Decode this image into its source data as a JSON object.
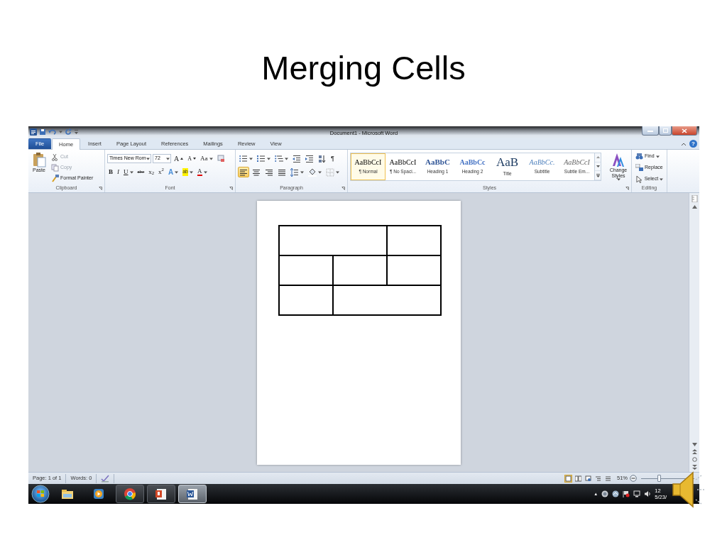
{
  "slide_title": "Merging Cells",
  "window": {
    "title": "Document1 - Microsoft Word"
  },
  "tabs": [
    {
      "label": "File",
      "kind": "file",
      "selected": false
    },
    {
      "label": "Home",
      "kind": "tab",
      "selected": true
    },
    {
      "label": "Insert",
      "kind": "tab",
      "selected": false
    },
    {
      "label": "Page Layout",
      "kind": "tab",
      "selected": false
    },
    {
      "label": "References",
      "kind": "tab",
      "selected": false
    },
    {
      "label": "Mailings",
      "kind": "tab",
      "selected": false
    },
    {
      "label": "Review",
      "kind": "tab",
      "selected": false
    },
    {
      "label": "View",
      "kind": "tab",
      "selected": false
    }
  ],
  "help": "?",
  "clipboard": {
    "label": "Clipboard",
    "paste": "Paste",
    "items": [
      {
        "label": "Cut",
        "kind": "cut",
        "disabled": true
      },
      {
        "label": "Copy",
        "kind": "copy",
        "disabled": true
      },
      {
        "label": "Format Painter",
        "kind": "painter",
        "disabled": false
      }
    ]
  },
  "font": {
    "label": "Font",
    "name": "Times New Rom",
    "size": "72",
    "row1": [
      {
        "label": "A",
        "kind": "grow"
      },
      {
        "label": "A",
        "kind": "shrink"
      },
      {
        "label": "Aa",
        "kind": "case"
      }
    ],
    "row2": [
      {
        "label": "B",
        "kind": "bold"
      },
      {
        "label": "I",
        "kind": "italic"
      },
      {
        "label": "U",
        "kind": "underline"
      },
      {
        "label": "abc",
        "kind": "strike"
      },
      {
        "label": "x$_{2}$",
        "kind": "sub"
      },
      {
        "label": "x$^{2}$",
        "kind": "sup"
      },
      {
        "label": "A",
        "kind": "effects"
      },
      {
        "label": "ab",
        "kind": "highlight"
      },
      {
        "label": "A",
        "kind": "color"
      }
    ]
  },
  "paragraph": {
    "label": "Paragraph",
    "marks": "¶",
    "alignment": [
      {
        "kind": "left",
        "selected": true
      },
      {
        "kind": "center",
        "selected": false
      },
      {
        "kind": "right",
        "selected": false
      },
      {
        "kind": "justify",
        "selected": false
      }
    ]
  },
  "styles": {
    "label": "Styles",
    "change": "Change Styles",
    "items": [
      {
        "preview": "AaBbCcI",
        "name": "¶ Normal",
        "kind": "normal",
        "selected": true
      },
      {
        "preview": "AaBbCcI",
        "name": "¶ No Spaci...",
        "kind": "normal",
        "selected": false
      },
      {
        "preview": "AaBbC",
        "name": "Heading 1",
        "kind": "heading1",
        "selected": false
      },
      {
        "preview": "AaBbCc",
        "name": "Heading 2",
        "kind": "heading2",
        "selected": false
      },
      {
        "preview": "AaB",
        "name": "Title",
        "kind": "title",
        "selected": false
      },
      {
        "preview": "AaBbCc.",
        "name": "Subtitle",
        "kind": "subtitle",
        "selected": false
      },
      {
        "preview": "AaBbCcI",
        "name": "Subtle Em...",
        "kind": "emphasis",
        "selected": false
      }
    ]
  },
  "editing": {
    "label": "Editing",
    "items": [
      {
        "label": "Find",
        "kind": "find",
        "dropdown": true
      },
      {
        "label": "Replace",
        "kind": "replace",
        "dropdown": false
      },
      {
        "label": "Select",
        "kind": "select",
        "dropdown": true
      }
    ]
  },
  "table": {
    "rows": [
      {
        "cells": [
          {
            "merged": true
          },
          {
            "merged": false
          }
        ]
      },
      {
        "cells": [
          {
            "merged": false
          },
          {
            "merged": false
          },
          {
            "merged": false
          }
        ]
      },
      {
        "cells": [
          {
            "merged": false
          },
          {
            "merged": true
          }
        ]
      }
    ]
  },
  "status_bar": {
    "page": "Page: 1 of 1",
    "words": "Words: 0",
    "views": [
      {
        "selected": true
      },
      {
        "selected": false
      },
      {
        "selected": false
      },
      {
        "selected": false
      },
      {
        "selected": false
      }
    ],
    "zoom": {
      "reading": "51%",
      "level": 0.3
    }
  },
  "taskbar": {
    "apps": [
      {
        "kind": "explorer",
        "running": false,
        "active": false
      },
      {
        "kind": "media",
        "running": false,
        "active": false
      },
      {
        "kind": "chrome",
        "running": true,
        "active": false
      },
      {
        "kind": "powerpoint",
        "running": true,
        "active": false
      },
      {
        "kind": "word",
        "running": true,
        "active": true
      }
    ],
    "tray_arrow": "▲",
    "clock": [
      "12",
      "5/23/"
    ]
  }
}
